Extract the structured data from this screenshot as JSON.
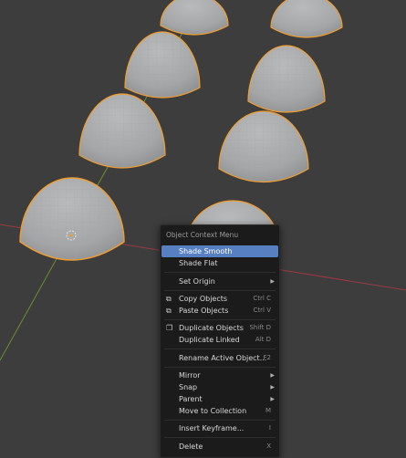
{
  "theme": {
    "background": "#3d3d3d",
    "sphere_fill": "#a9abad",
    "selection_outline": "#f29d2f",
    "axis_x_color": "#9a3a44",
    "axis_y_color": "#6b8f2c",
    "menu_bg": "#1b1b1b",
    "highlight": "#5680c2"
  },
  "context_menu": {
    "title": "Object Context Menu",
    "items": [
      {
        "label": "Shade Smooth",
        "shortcut": "",
        "submenu": false,
        "icon": "",
        "active": true
      },
      {
        "label": "Shade Flat",
        "shortcut": "",
        "submenu": false,
        "icon": ""
      },
      {
        "label": "Set Origin",
        "shortcut": "",
        "submenu": true,
        "icon": ""
      },
      {
        "label": "Copy Objects",
        "shortcut": "Ctrl C",
        "submenu": false,
        "icon": "copy-icon"
      },
      {
        "label": "Paste Objects",
        "shortcut": "Ctrl V",
        "submenu": false,
        "icon": "paste-icon"
      },
      {
        "label": "Duplicate Objects",
        "shortcut": "Shift D",
        "submenu": false,
        "icon": "duplicate-icon"
      },
      {
        "label": "Duplicate Linked",
        "shortcut": "Alt D",
        "submenu": false,
        "icon": ""
      },
      {
        "label": "Rename Active Object...",
        "shortcut": "F2",
        "submenu": false,
        "icon": ""
      },
      {
        "label": "Mirror",
        "shortcut": "",
        "submenu": true,
        "icon": ""
      },
      {
        "label": "Snap",
        "shortcut": "",
        "submenu": true,
        "icon": ""
      },
      {
        "label": "Parent",
        "shortcut": "",
        "submenu": true,
        "icon": ""
      },
      {
        "label": "Move to Collection",
        "shortcut": "M",
        "submenu": false,
        "icon": ""
      },
      {
        "label": "Insert Keyframe...",
        "shortcut": "I",
        "submenu": false,
        "icon": ""
      },
      {
        "label": "Delete",
        "shortcut": "X",
        "submenu": false,
        "icon": ""
      }
    ]
  }
}
